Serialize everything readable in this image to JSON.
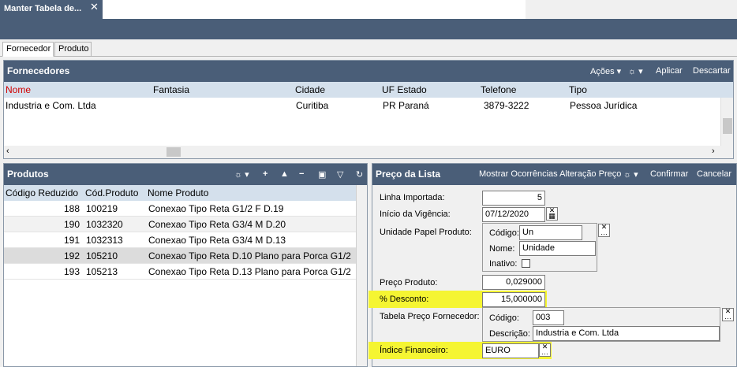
{
  "window": {
    "tab_title": "Manter Tabela de...",
    "close_glyph": "✕"
  },
  "subtabs": [
    "Fornecedor",
    "Produto"
  ],
  "fornecedores": {
    "title": "Fornecedores",
    "actions": [
      "Ações",
      "Aplicar",
      "Descartar"
    ],
    "columns": [
      "Nome",
      "Fantasia",
      "Cidade",
      "UF Estado",
      "Telefone",
      "Tipo"
    ],
    "rows": [
      [
        "Industria e Com. Ltda",
        "",
        "Curitiba",
        "PR Paraná",
        "3879-3222",
        "Pessoa Jurídica"
      ]
    ]
  },
  "produtos": {
    "title": "Produtos",
    "columns": [
      "Código Reduzido",
      "Cód.Produto",
      "Nome Produto"
    ],
    "rows": [
      [
        "188",
        "100219",
        "Conexao Tipo Reta G1/2 F D.19"
      ],
      [
        "190",
        "1032320",
        "Conexao Tipo Reta G3/4 M D.20"
      ],
      [
        "191",
        "1032313",
        "Conexao Tipo Reta G3/4 M D.13"
      ],
      [
        "192",
        "105210",
        "Conexao Tipo Reta D.10 Plano para Porca G1/2"
      ],
      [
        "193",
        "105213",
        "Conexao Tipo Reta D.13 Plano para Porca G1/2"
      ]
    ]
  },
  "preco": {
    "title": "Preço da Lista",
    "actions": [
      "Mostrar Ocorrências Alteração Preço",
      "Confirmar",
      "Cancelar"
    ],
    "linha_label": "Linha Importada:",
    "linha_value": "5",
    "inicio_label": "Início da Vigência:",
    "inicio_value": "07/12/2020",
    "unidade_label": "Unidade Papel Produto:",
    "unidade_codigo_label": "Código:",
    "unidade_codigo_value": "Un",
    "unidade_nome_label": "Nome:",
    "unidade_nome_value": "Unidade",
    "unidade_inativo_label": "Inativo:",
    "preco_label": "Preço Produto:",
    "preco_value": "0,029000",
    "desconto_label": "% Desconto:",
    "desconto_value": "15,000000",
    "tabela_label": "Tabela Preço Fornecedor:",
    "tabela_codigo_label": "Código:",
    "tabela_codigo_value": "003",
    "tabela_desc_label": "Descrição:",
    "tabela_desc_value": "Industria e Com. Ltda",
    "indice_label": "Índice Financeiro:",
    "indice_value": "EURO"
  },
  "colors": {
    "header": "#4a5e78",
    "highlight": "#f5f532",
    "required": "#d00000"
  }
}
